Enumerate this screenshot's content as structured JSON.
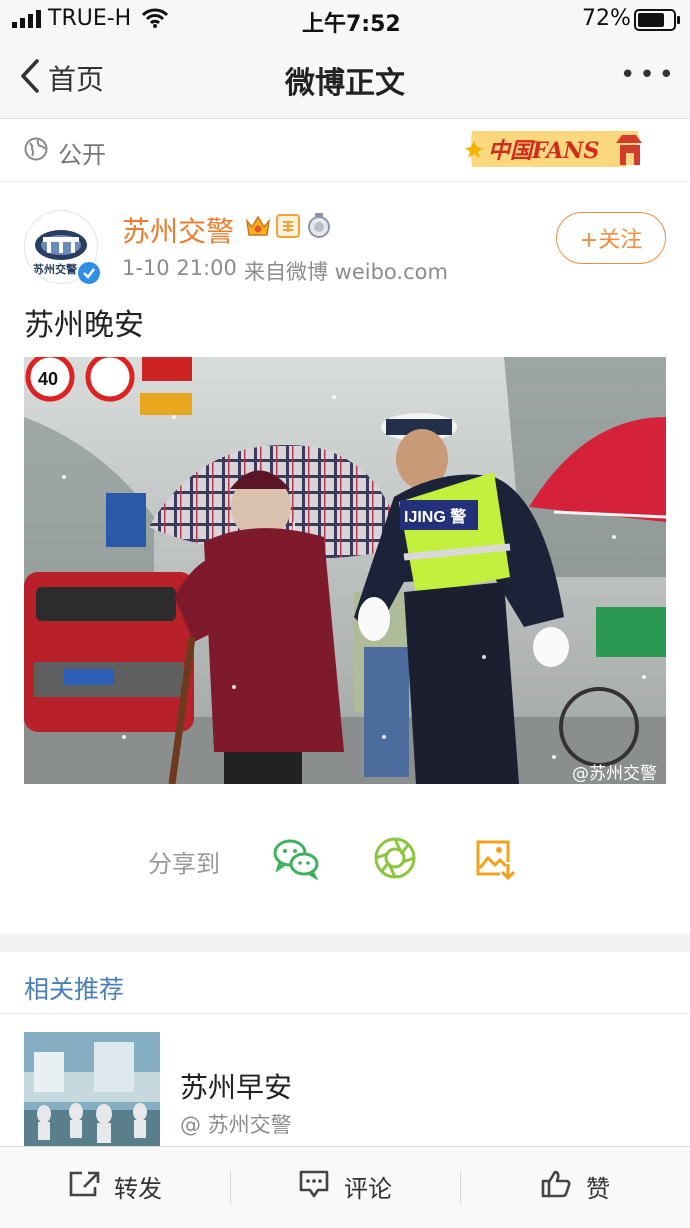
{
  "status_bar": {
    "carrier": "TRUE-H",
    "time": "上午7:52",
    "battery": "72%"
  },
  "nav": {
    "back_label": "首页",
    "title": "微博正文",
    "more": "•••"
  },
  "visibility": {
    "label": "公开",
    "badge_text": "中国FANS"
  },
  "post": {
    "author": "苏州交警",
    "avatar_text": "苏州交警",
    "timestamp": "1-10 21:00",
    "source": "来自微博 weibo.com",
    "follow_label": "+关注",
    "text": "苏州晚安",
    "photo_watermark": "@苏州交警",
    "sign_text": "40",
    "police_vest_text": "IJING 警"
  },
  "share": {
    "label": "分享到"
  },
  "related": {
    "header": "相关推荐",
    "items": [
      {
        "title": "苏州早安",
        "author": "@ 苏州交警"
      }
    ]
  },
  "bottom_bar": {
    "repost": "转发",
    "comment": "评论",
    "like": "赞"
  }
}
